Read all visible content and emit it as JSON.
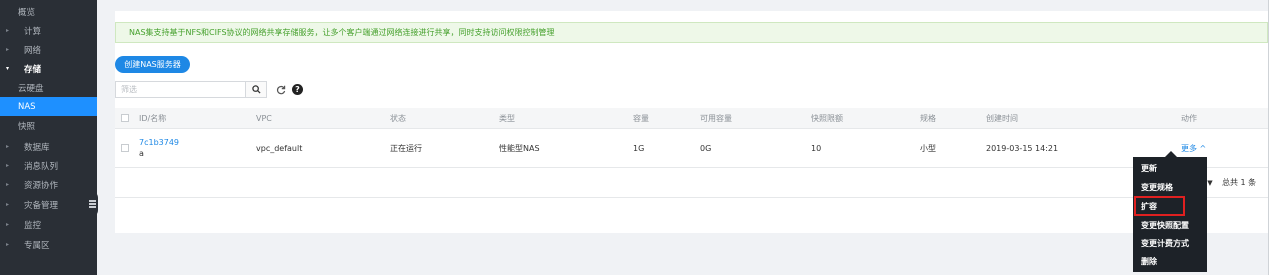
{
  "sidebar": {
    "items": [
      {
        "label": "概览",
        "level": "sub",
        "caret": ""
      },
      {
        "label": "计算",
        "level": "top",
        "caret": "▸"
      },
      {
        "label": "网络",
        "level": "top",
        "caret": "▸"
      },
      {
        "label": "存储",
        "level": "top",
        "caret": "▾",
        "state": "expanded"
      },
      {
        "label": "云硬盘",
        "level": "sub",
        "caret": ""
      },
      {
        "label": "NAS",
        "level": "sub",
        "caret": "",
        "state": "active"
      },
      {
        "label": "快照",
        "level": "sub",
        "caret": ""
      },
      {
        "label": "数据库",
        "level": "top",
        "caret": "▸"
      },
      {
        "label": "消息队列",
        "level": "top",
        "caret": "▸"
      },
      {
        "label": "资源协作",
        "level": "top",
        "caret": "▸"
      },
      {
        "label": "灾备管理",
        "level": "top",
        "caret": "▸"
      },
      {
        "label": "监控",
        "level": "top",
        "caret": "▸"
      },
      {
        "label": "专属区",
        "level": "top",
        "caret": "▸"
      }
    ]
  },
  "main": {
    "notice": "NAS集支持基于NFS和CIFS协议的网络共享存储服务，让多个客户端通过网络连接进行共享，同时支持访问权限控制管理",
    "create_button": "创建NAS服务器",
    "search_placeholder": "筛选",
    "search_icon": "search-icon",
    "refresh_icon": "refresh-icon",
    "help_icon": "help-icon"
  },
  "table": {
    "columns": [
      "ID/名称",
      "VPC",
      "状态",
      "类型",
      "容量",
      "可用容量",
      "快照限额",
      "规格",
      "创建时间",
      "动作"
    ],
    "rows": [
      {
        "id": "7c1b3749",
        "name": "a",
        "vpc": "vpc_default",
        "status": "正在运行",
        "type": "性能型NAS",
        "capacity": "1G",
        "available": "0G",
        "snapshot_limit": "10",
        "spec": "小型",
        "created": "2019-03-15 14:21",
        "action": "更多 ^"
      }
    ],
    "total": "总共 1 条"
  },
  "dropdown": {
    "items": [
      "更新",
      "变更规格",
      "扩容",
      "变更快照配置",
      "变更计费方式",
      "删除"
    ],
    "highlighted": "扩容"
  },
  "colors": {
    "sidebar_bg": "#2a2f36",
    "accent": "#1e88e5",
    "notice_text": "#45a02c",
    "highlight_border": "#e02020"
  }
}
